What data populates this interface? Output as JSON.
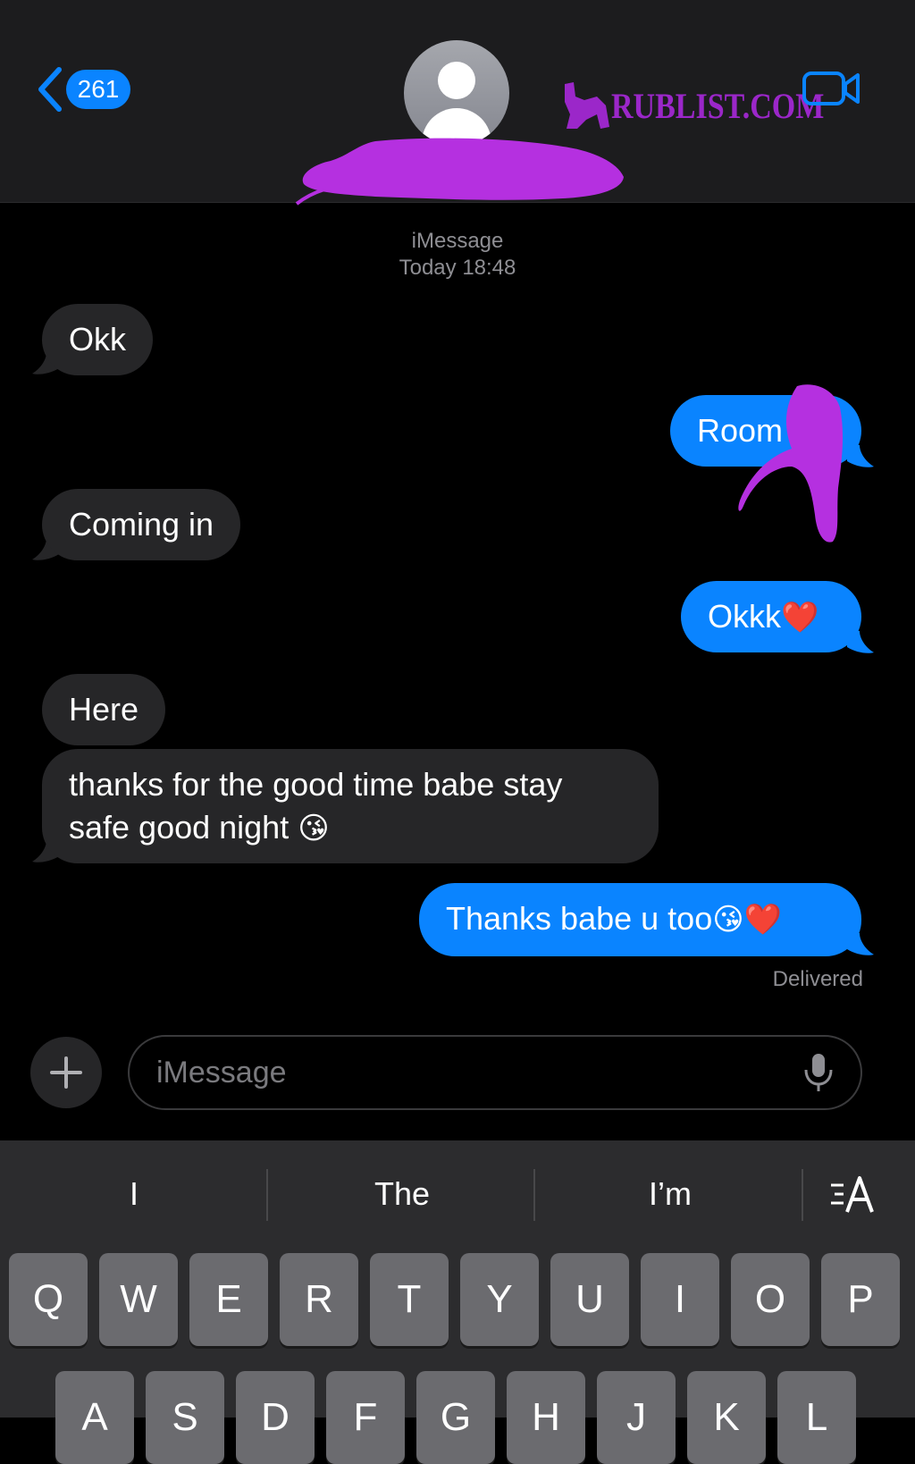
{
  "header": {
    "back_badge": "261",
    "watermark_text": "RUBLIST.COM"
  },
  "conversation": {
    "service": "iMessage",
    "timestamp": "Today 18:48",
    "messages": [
      {
        "from": "them",
        "text": "Okk"
      },
      {
        "from": "me",
        "text": "Room"
      },
      {
        "from": "them",
        "text": "Coming in"
      },
      {
        "from": "me",
        "text": "Okkk",
        "emoji": "❤️"
      },
      {
        "from": "them",
        "text": "Here"
      },
      {
        "from": "them",
        "line1": "thanks for the good time babe stay",
        "line2": "safe good night",
        "emoji": "😘"
      },
      {
        "from": "me",
        "text": "Thanks babe u too",
        "emoji": "😘❤️"
      }
    ],
    "status": "Delivered"
  },
  "compose": {
    "placeholder": "iMessage",
    "value": ""
  },
  "keyboard": {
    "suggestions": [
      "I",
      "The",
      "I’m"
    ],
    "row1": [
      "Q",
      "W",
      "E",
      "R",
      "T",
      "Y",
      "U",
      "I",
      "O",
      "P"
    ],
    "row2": [
      "A",
      "S",
      "D",
      "F",
      "G",
      "H",
      "J",
      "K",
      "L"
    ]
  },
  "colors": {
    "accent": "#0a84ff",
    "incoming_bubble": "#262628",
    "header_bg": "#1c1c1e",
    "redaction": "#b530e0"
  },
  "icons": [
    "chevron-left-icon",
    "person-icon",
    "video-camera-icon",
    "plus-icon",
    "microphone-icon",
    "text-format-icon"
  ]
}
